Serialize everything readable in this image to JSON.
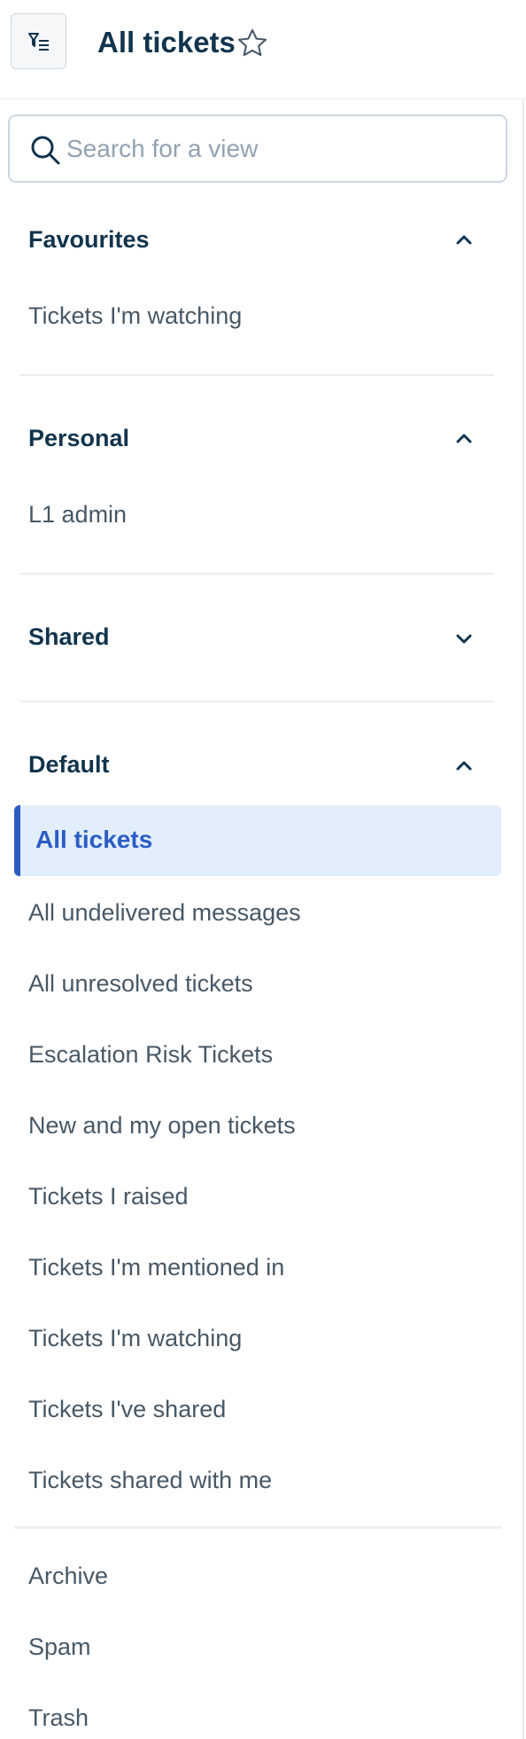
{
  "header": {
    "title": "All tickets",
    "filter_icon": "filter-list-icon",
    "star_icon": "star-outline-icon"
  },
  "search": {
    "placeholder": "Search for a view",
    "value": ""
  },
  "sections": {
    "favourites": {
      "title": "Favourites",
      "expanded": true,
      "items": [
        "Tickets I'm watching"
      ]
    },
    "personal": {
      "title": "Personal",
      "expanded": true,
      "items": [
        "L1 admin"
      ]
    },
    "shared": {
      "title": "Shared",
      "expanded": false
    },
    "default": {
      "title": "Default",
      "expanded": true,
      "active_item": "All tickets",
      "items": [
        "All undelivered messages",
        "All unresolved tickets",
        "Escalation Risk Tickets",
        "New and my open tickets",
        "Tickets I raised",
        "Tickets I'm mentioned in",
        "Tickets I'm watching",
        "Tickets I've shared",
        "Tickets shared with me"
      ]
    },
    "other": {
      "items": [
        "Archive",
        "Spam",
        "Trash"
      ]
    }
  },
  "colors": {
    "accent": "#2c5cc5",
    "active_bg": "#e2effa",
    "heading": "#12344d",
    "item_text": "#475867",
    "placeholder": "#92a2b1"
  }
}
